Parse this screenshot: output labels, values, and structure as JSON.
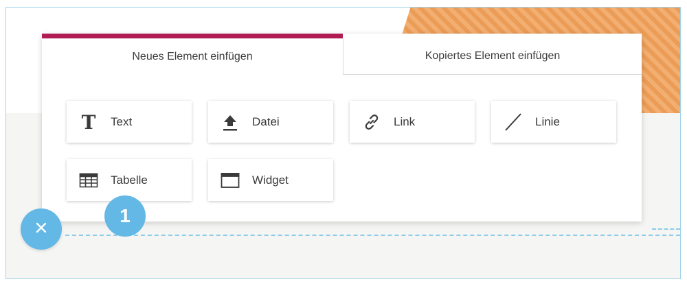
{
  "tabs": [
    {
      "label": "Neues Element einfügen",
      "active": true
    },
    {
      "label": "Kopiertes Element einfügen",
      "active": false
    }
  ],
  "elements": [
    {
      "label": "Text",
      "icon": "text-icon"
    },
    {
      "label": "Datei",
      "icon": "upload-icon"
    },
    {
      "label": "Link",
      "icon": "link-icon"
    },
    {
      "label": "Linie",
      "icon": "line-icon"
    },
    {
      "label": "Tabelle",
      "icon": "table-icon"
    },
    {
      "label": "Widget",
      "icon": "widget-icon"
    }
  ],
  "close_button": {
    "icon": "close-icon",
    "symbol": "×"
  },
  "step_badge": {
    "number": "1"
  },
  "colors": {
    "accent": "#b01b52",
    "badge": "#63b8e6",
    "guide": "#8ccbec",
    "ornament": "#f1a45e"
  }
}
